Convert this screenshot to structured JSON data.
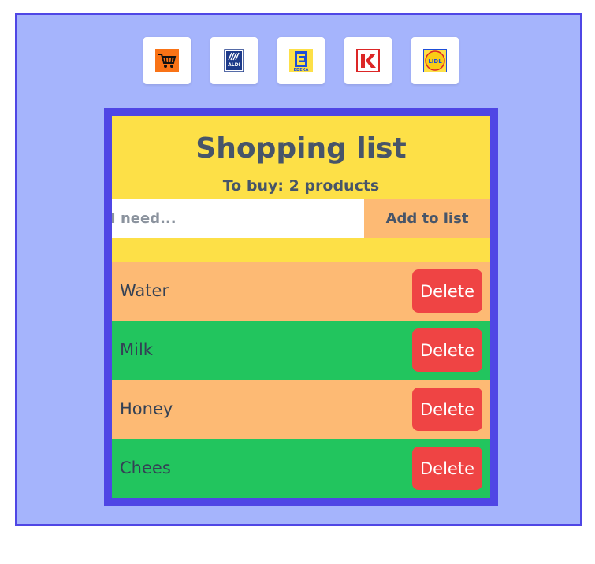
{
  "stores": [
    {
      "name": "cart-icon",
      "color": "#f97316"
    },
    {
      "name": "aldi-logo",
      "color": "#1d3a8a",
      "text": "ALDI"
    },
    {
      "name": "edeka-logo",
      "color": "#1d4ed8",
      "text": "EDEKA"
    },
    {
      "name": "kaufland-logo",
      "color": "#dc2626"
    },
    {
      "name": "lidl-logo",
      "color": "#facc15",
      "text": "LIDL"
    }
  ],
  "header": {
    "title": "Shopping list",
    "subtitle": "To buy: 2 products"
  },
  "form": {
    "placeholder": "I need...",
    "add_label": "Add to list"
  },
  "items": [
    {
      "name": "Water",
      "delete_label": "Delete",
      "color": "#fdba74"
    },
    {
      "name": "Milk",
      "delete_label": "Delete",
      "color": "#22c55e"
    },
    {
      "name": "Honey",
      "delete_label": "Delete",
      "color": "#fdba74"
    },
    {
      "name": "Chees",
      "delete_label": "Delete",
      "color": "#22c55e"
    }
  ],
  "colors": {
    "page_bg": "#a5b4fc",
    "border": "#4f46e5",
    "card_bg": "#fde047",
    "delete_button": "#ef4444"
  }
}
